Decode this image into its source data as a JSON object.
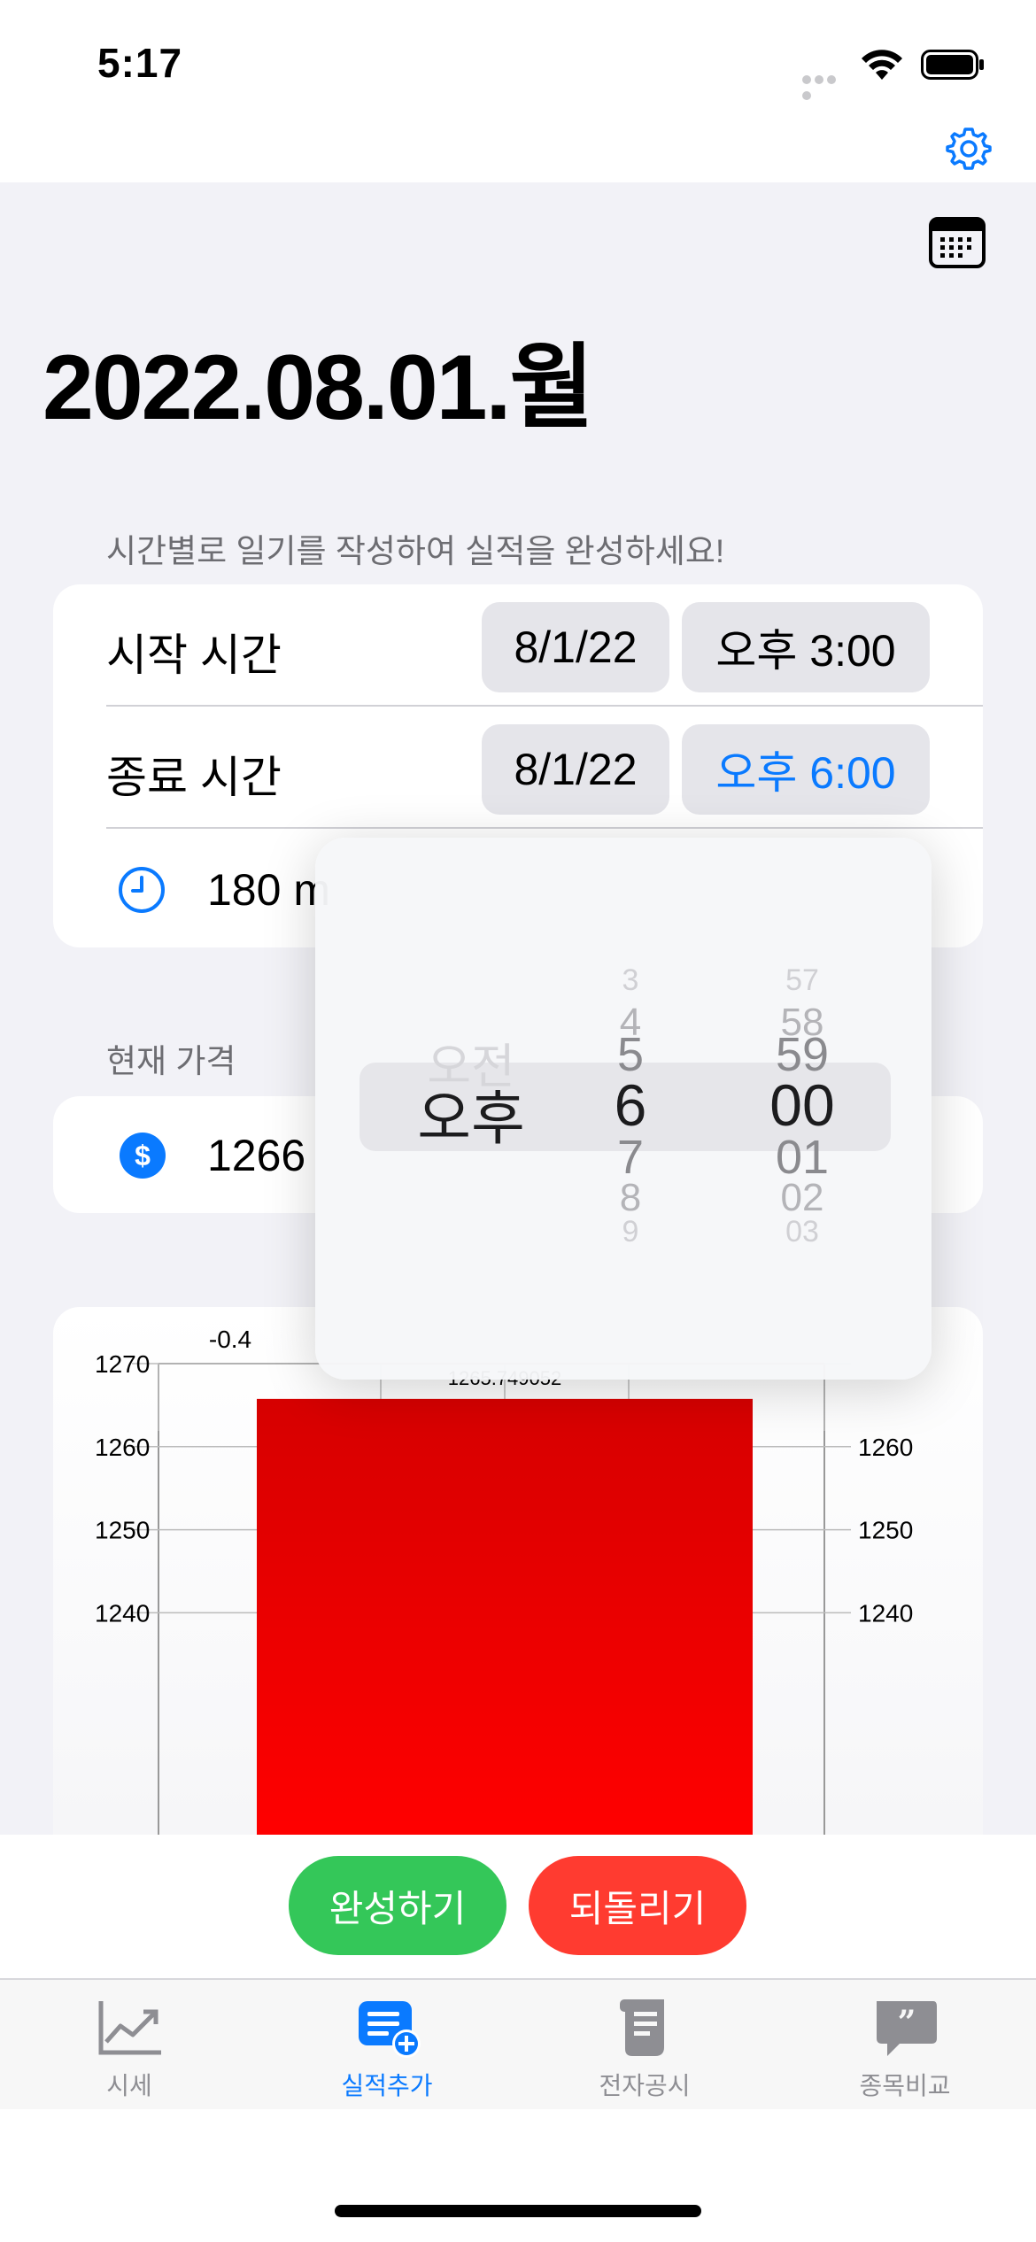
{
  "status_bar": {
    "time": "5:17"
  },
  "header": {
    "date_title": "2022.08.01.월"
  },
  "sections": {
    "diary_header": "시간별로 일기를 작성하여 실적을 완성하세요!",
    "price_header": "현재 가격"
  },
  "schedule": {
    "start": {
      "label": "시작 시간",
      "date": "8/1/22",
      "time": "오후 3:00"
    },
    "end": {
      "label": "종료 시간",
      "date": "8/1/22",
      "time": "오후 6:00"
    },
    "duration_text": "180 m"
  },
  "price": {
    "value": "1266"
  },
  "chart_data": {
    "type": "bar",
    "left_annotation": "-0.4",
    "bar_label": "1265.749052",
    "values": [
      1265.749052
    ],
    "y_ticks_left": [
      "1270",
      "1260",
      "1250",
      "1240"
    ],
    "y_ticks_right": [
      "1260",
      "1250",
      "1240"
    ],
    "ylim": [
      1237,
      1270
    ],
    "bar_color": "#ff0000",
    "grid": true
  },
  "picker": {
    "period": {
      "above": [
        "오전"
      ],
      "selected": "오후",
      "below": []
    },
    "hour": {
      "above": [
        "3",
        "4",
        "5"
      ],
      "selected": "6",
      "below": [
        "7",
        "8",
        "9"
      ]
    },
    "minute": {
      "above": [
        "57",
        "58",
        "59"
      ],
      "selected": "00",
      "below": [
        "01",
        "02",
        "03"
      ]
    }
  },
  "actions": {
    "complete": "완성하기",
    "revert": "되돌리기"
  },
  "tabs": [
    {
      "label": "시세",
      "icon": "chart-line-icon",
      "active": false
    },
    {
      "label": "실적추가",
      "icon": "add-document-icon",
      "active": true
    },
    {
      "label": "전자공시",
      "icon": "scroll-icon",
      "active": false
    },
    {
      "label": "종목비교",
      "icon": "quote-bubble-icon",
      "active": false
    }
  ],
  "colors": {
    "accent": "#0a7aff",
    "complete": "#34c759",
    "revert": "#ff3b30",
    "bar": "#ff0000"
  }
}
